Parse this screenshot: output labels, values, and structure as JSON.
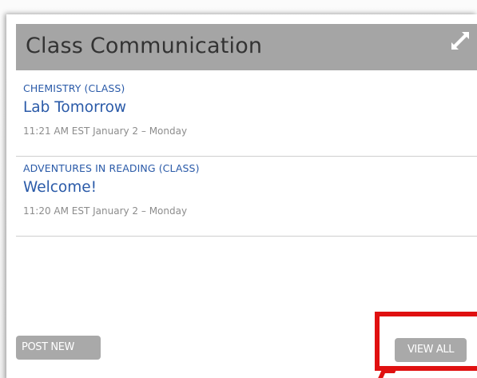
{
  "widget": {
    "title": "Class Communication",
    "expand_icon": "expand-arrows-icon"
  },
  "messages": [
    {
      "class_name": "CHEMISTRY (CLASS)",
      "title": "Lab Tomorrow",
      "timestamp": "11:21 AM EST January 2 – Monday"
    },
    {
      "class_name": "ADVENTURES IN READING (CLASS)",
      "title": "Welcome!",
      "timestamp": "11:20 AM EST January 2 – Monday"
    }
  ],
  "actions": {
    "post_new_label": "POST NEW",
    "view_all_label": "VIEW ALL"
  },
  "colors": {
    "header_bg": "#a5a5a5",
    "link_blue": "#2a5aa8",
    "button_bg": "#a9a9a9",
    "highlight_red": "#e01010"
  }
}
